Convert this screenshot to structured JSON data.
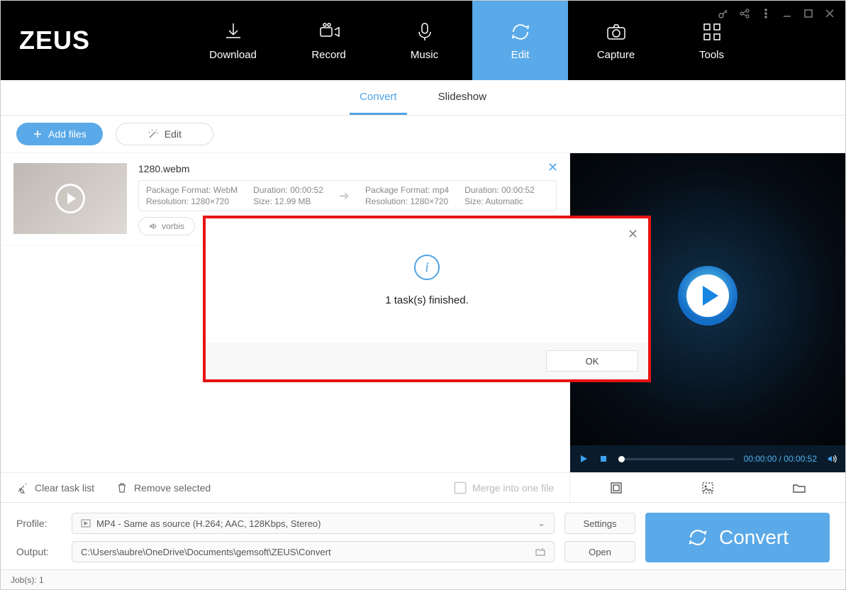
{
  "app": {
    "logo": "ZEUS"
  },
  "nav": [
    {
      "label": "Download"
    },
    {
      "label": "Record"
    },
    {
      "label": "Music"
    },
    {
      "label": "Edit"
    },
    {
      "label": "Capture"
    },
    {
      "label": "Tools"
    }
  ],
  "submenu": {
    "convert": "Convert",
    "slideshow": "Slideshow"
  },
  "toolbar": {
    "addFiles": "Add files",
    "edit": "Edit"
  },
  "item": {
    "title": "1280.webm",
    "src": {
      "pkg": "Package Format: WebM",
      "res": "Resolution: 1280×720",
      "dur": "Duration: 00:00:52",
      "size": "Size: 12.99 MB"
    },
    "dst": {
      "pkg": "Package Format: mp4",
      "res": "Resolution: 1280×720",
      "dur": "Duration: 00:00:52",
      "size": "Size: Automatic"
    },
    "audioCodec": "vorbis"
  },
  "listFooter": {
    "clear": "Clear task list",
    "remove": "Remove selected",
    "merge": "Merge into one file"
  },
  "preview": {
    "time": "00:00:00 / 00:00:52"
  },
  "bottom": {
    "profileLabel": "Profile:",
    "profileValue": "MP4 - Same as source (H.264; AAC, 128Kbps, Stereo)",
    "outputLabel": "Output:",
    "outputValue": "C:\\Users\\aubre\\OneDrive\\Documents\\gemsoft\\ZEUS\\Convert",
    "settings": "Settings",
    "open": "Open",
    "convert": "Convert"
  },
  "status": {
    "jobs": "Job(s): 1"
  },
  "dialog": {
    "message": "1 task(s) finished.",
    "ok": "OK"
  }
}
